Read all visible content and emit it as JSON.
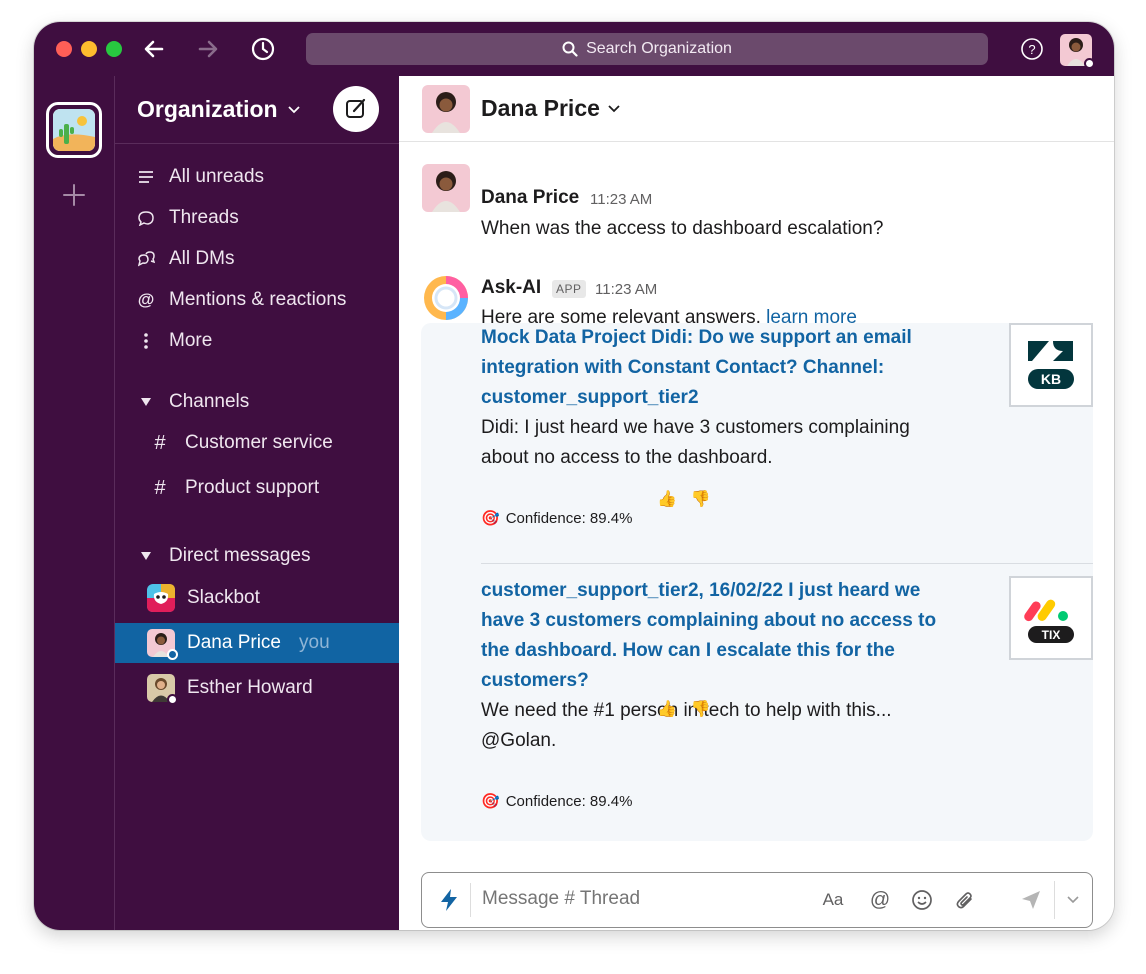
{
  "window": {
    "search_placeholder": "Search Organization"
  },
  "sidebar": {
    "org_name": "Organization",
    "nav": [
      {
        "label": "All unreads",
        "icon": "list-icon"
      },
      {
        "label": "Threads",
        "icon": "thread-icon"
      },
      {
        "label": "All DMs",
        "icon": "dms-icon"
      },
      {
        "label": "Mentions & reactions",
        "icon": "at-icon"
      },
      {
        "label": "More",
        "icon": "more-vertical-icon"
      }
    ],
    "channels_header": "Channels",
    "channels": [
      {
        "name": "Customer service"
      },
      {
        "name": "Product support"
      }
    ],
    "dms_header": "Direct messages",
    "dms": [
      {
        "name": "Slackbot",
        "suffix": ""
      },
      {
        "name": "Dana Price",
        "suffix": "you"
      },
      {
        "name": "Esther Howard",
        "suffix": ""
      }
    ]
  },
  "main": {
    "header_name": "Dana Price",
    "messages": [
      {
        "author": "Dana Price",
        "time": "11:23 AM",
        "text": "When was the access to dashboard escalation?"
      },
      {
        "author": "Ask-AI",
        "badge": "APP",
        "time": "11:23 AM",
        "text": "Here are some relevant answers,",
        "link": "learn more"
      }
    ],
    "answers": [
      {
        "title": "Mock Data Project Didi: Do we support an email integration with Constant Contact? Channel: customer_support_tier2",
        "body": "Didi: I just heard we have 3 customers complaining about no access to the dashboard.",
        "confidence": "Confidence: 89.4%",
        "logo_text": "KB"
      },
      {
        "title": "customer_support_tier2, 16/02/22 I just heard we have 3 customers complaining about no access to the dashboard. How can I escalate this for the customers?",
        "body": "We need the #1 person in tech to help with this... @Golan.",
        "confidence": "Confidence: 89.4%",
        "logo_text": "TIX"
      }
    ],
    "composer": {
      "placeholder": "Message # Thread",
      "format_label": "Aa"
    }
  },
  "colors": {
    "aubergine": "#3f0e40",
    "active_blue": "#1164a3",
    "link_blue": "#1264a3"
  }
}
